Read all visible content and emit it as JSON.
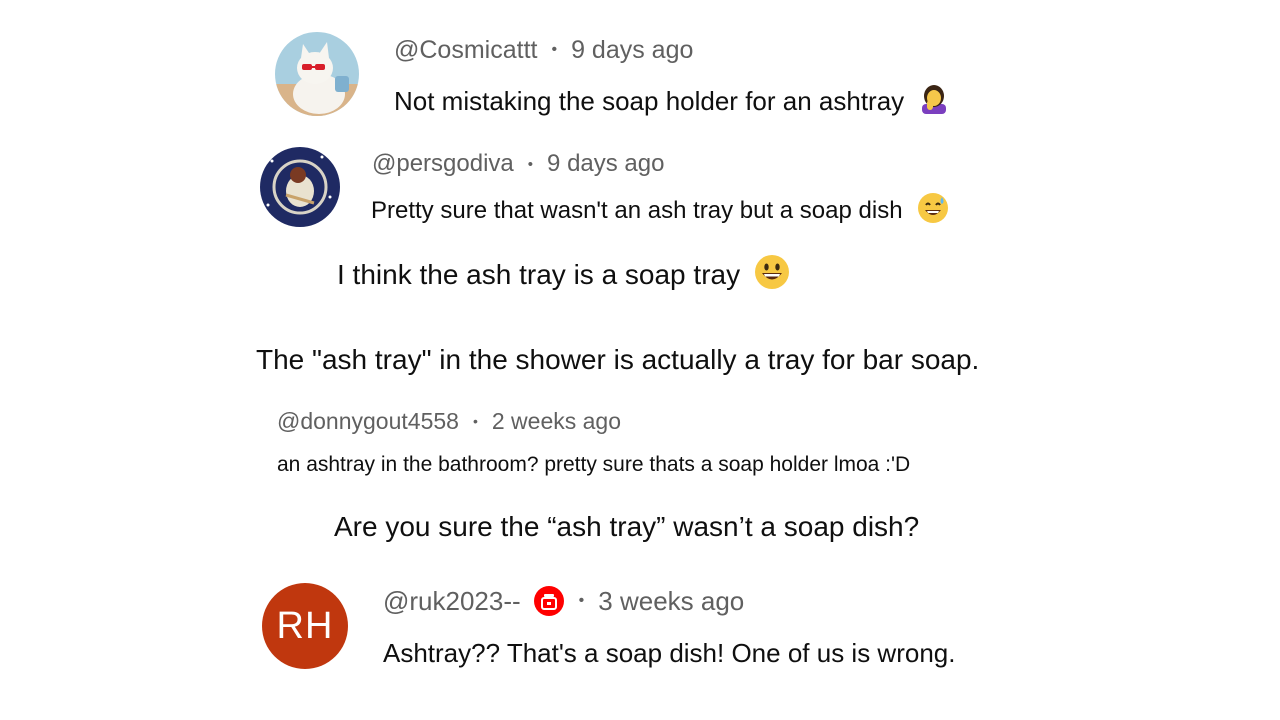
{
  "comments": [
    {
      "handle": "@Cosmicattt",
      "time": "9 days ago",
      "text": "Not mistaking the soap holder for an ashtray",
      "emoji": "facepalm-woman"
    },
    {
      "handle": "@persgodiva",
      "time": "9 days ago",
      "text": "Pretty sure that wasn't an ash tray but a soap dish",
      "emoji": "grinning-sweat"
    },
    {
      "handle": "@donnygout4558",
      "time": "2 weeks ago",
      "text": "an ashtray in the bathroom? pretty sure thats a soap holder lmoa :'D"
    },
    {
      "handle": "@ruk2023--",
      "time": "3 weeks ago",
      "text": "Ashtray?? That's a soap dish! One of us is wrong.",
      "avatar_initials": "RH",
      "avatar_color": "#c0370e",
      "badge_color": "#ff0000"
    }
  ],
  "captions": {
    "line1": "I think the ash tray is a soap tray",
    "line2": "The \"ash tray\" in the shower is actually a tray for bar soap.",
    "line3": "Are you sure the “ash tray” wasn’t a soap dish?"
  },
  "separator": "•"
}
